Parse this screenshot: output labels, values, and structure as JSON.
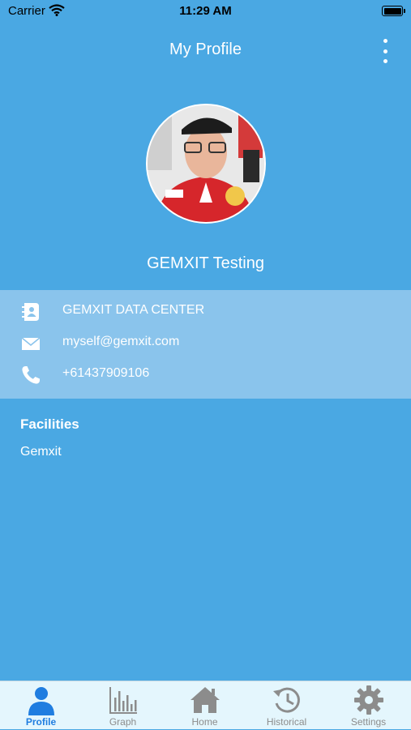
{
  "status_bar": {
    "carrier": "Carrier",
    "time": "11:29 AM"
  },
  "nav": {
    "title": "My Profile",
    "menu_icon": "more-vertical-icon"
  },
  "profile": {
    "name": "GEMXIT Testing",
    "contact": {
      "company": "GEMXIT DATA CENTER",
      "email": "myself@gemxit.com",
      "phone": "+61437909106"
    },
    "facilities_title": "Facilities",
    "facilities": [
      "Gemxit"
    ]
  },
  "tabs": [
    {
      "label": "Profile",
      "icon": "person-icon",
      "active": true
    },
    {
      "label": "Graph",
      "icon": "bar-graph-icon",
      "active": false
    },
    {
      "label": "Home",
      "icon": "home-icon",
      "active": false
    },
    {
      "label": "Historical",
      "icon": "history-icon",
      "active": false
    },
    {
      "label": "Settings",
      "icon": "gear-icon",
      "active": false
    }
  ],
  "colors": {
    "background": "#4aa8e3",
    "contact_card": "#8ac4ec",
    "tab_bar": "#e4f6fd",
    "active_tab": "#1f7de0",
    "inactive_tab": "#8c8c8c"
  }
}
